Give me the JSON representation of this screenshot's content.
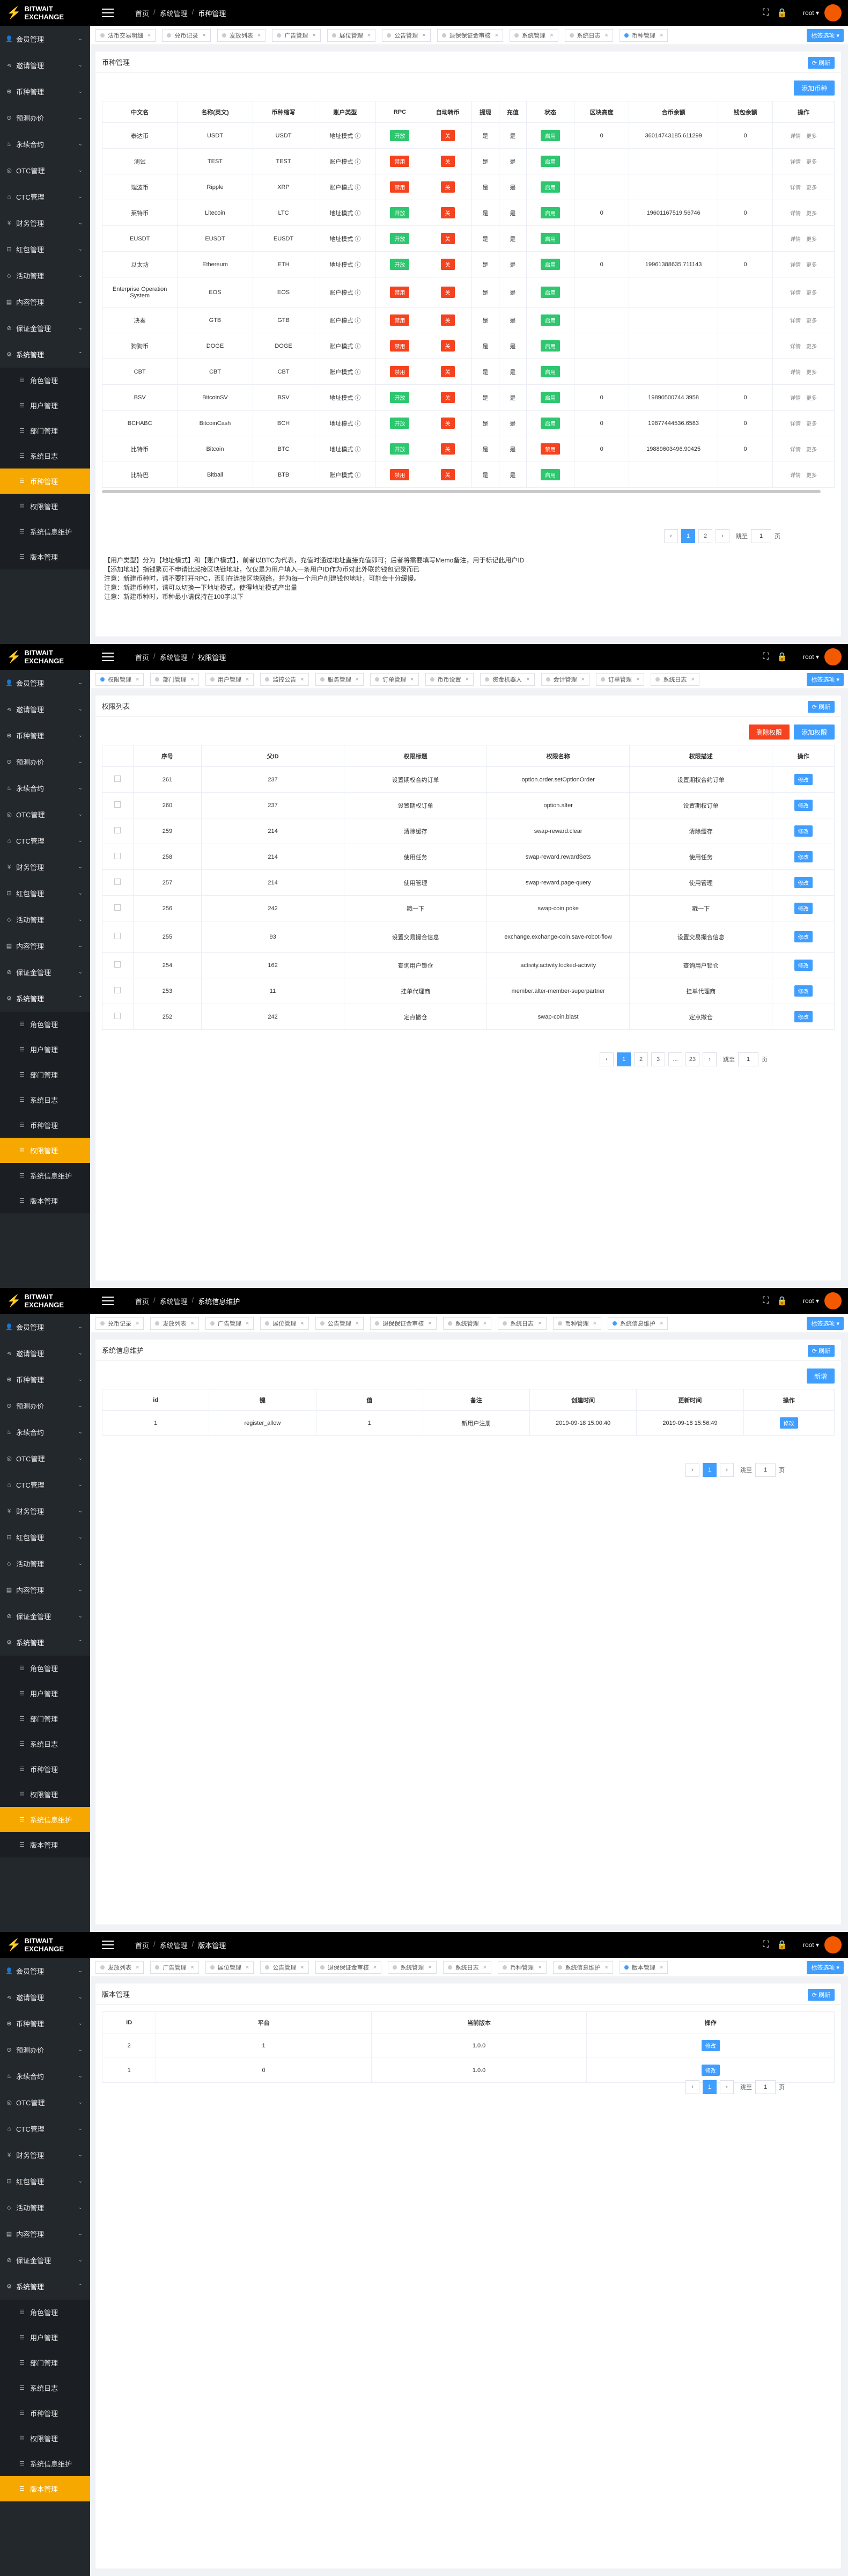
{
  "app": {
    "logo_text": "BITWAIT EXCHANGE",
    "user": "root ▾",
    "tag_nav_label": "标签选项 ▾",
    "refresh_label": "⟳ 刷新"
  },
  "sidebar": {
    "menus": [
      {
        "label": "会员管理",
        "icon": "👤"
      },
      {
        "label": "邀请管理",
        "icon": "⋖"
      },
      {
        "label": "币种管理",
        "icon": "⊕"
      },
      {
        "label": "预测办价",
        "icon": "⊙"
      },
      {
        "label": "永续合约",
        "icon": "♨"
      },
      {
        "label": "OTC管理",
        "icon": "◎"
      },
      {
        "label": "CTC管理",
        "icon": "⌂"
      },
      {
        "label": "财务管理",
        "icon": "¥"
      },
      {
        "label": "红包管理",
        "icon": "⊡"
      },
      {
        "label": "活动管理",
        "icon": "◇"
      },
      {
        "label": "内容管理",
        "icon": "▤"
      },
      {
        "label": "保证金管理",
        "icon": "⊘"
      },
      {
        "label": "系统管理",
        "icon": "⚙"
      }
    ],
    "submenus": [
      {
        "label": "角色管理"
      },
      {
        "label": "用户管理"
      },
      {
        "label": "部门管理"
      },
      {
        "label": "系统日志"
      },
      {
        "label": "币种管理"
      },
      {
        "label": "权限管理"
      },
      {
        "label": "系统信息维护"
      },
      {
        "label": "版本管理"
      }
    ]
  },
  "panels": [
    {
      "breadcrumb": [
        "首页",
        "系统管理",
        "币种管理"
      ],
      "tags": [
        {
          "label": "法币交易明细",
          "active": false
        },
        {
          "label": "兑币记录",
          "active": false
        },
        {
          "label": "发放列表",
          "active": false
        },
        {
          "label": "广告管理",
          "active": false
        },
        {
          "label": "展位管理",
          "active": false
        },
        {
          "label": "公告管理",
          "active": false
        },
        {
          "label": "退保保证金审核",
          "active": false
        },
        {
          "label": "系统管理",
          "active": false
        },
        {
          "label": "系统日志",
          "active": false
        },
        {
          "label": "币种管理",
          "active": true
        }
      ],
      "card_title": "币种管理",
      "toolbar": {
        "add": "添加币种"
      },
      "table": {
        "headers": [
          "中文名",
          "名称(英文)",
          "币种缩写",
          "账户类型",
          "RPC",
          "自动转币",
          "提现",
          "充值",
          "状态",
          "区块高度",
          "合币余额",
          "钱包余额",
          "操作"
        ],
        "rows": [
          {
            "cn": "泰达币",
            "en": "USDT",
            "unit": "USDT",
            "acct": "地址模式 ⓘ",
            "rpc": "开放",
            "rpcc": "g",
            "auto": "关",
            "w": "是",
            "d": "是",
            "st": "启用",
            "h": "0",
            "cb": "36014743185.611299",
            "wb": "0"
          },
          {
            "cn": "测试",
            "en": "TEST",
            "unit": "TEST",
            "acct": "账户模式 ⓘ",
            "rpc": "禁用",
            "rpcc": "r",
            "auto": "关",
            "w": "是",
            "d": "是",
            "st": "启用",
            "h": "",
            "cb": "",
            "wb": ""
          },
          {
            "cn": "瑞波币",
            "en": "Ripple",
            "unit": "XRP",
            "acct": "账户模式 ⓘ",
            "rpc": "禁用",
            "rpcc": "r",
            "auto": "关",
            "w": "是",
            "d": "是",
            "st": "启用",
            "h": "",
            "cb": "",
            "wb": ""
          },
          {
            "cn": "莱特币",
            "en": "Litecoin",
            "unit": "LTC",
            "acct": "地址模式 ⓘ",
            "rpc": "开放",
            "rpcc": "g",
            "auto": "关",
            "w": "是",
            "d": "是",
            "st": "启用",
            "h": "0",
            "cb": "19601167519.56746",
            "wb": "0"
          },
          {
            "cn": "EUSDT",
            "en": "EUSDT",
            "unit": "EUSDT",
            "acct": "地址模式 ⓘ",
            "rpc": "开放",
            "rpcc": "g",
            "auto": "关",
            "w": "是",
            "d": "是",
            "st": "启用",
            "h": "",
            "cb": "",
            "wb": ""
          },
          {
            "cn": "以太坊",
            "en": "Ethereum",
            "unit": "ETH",
            "acct": "地址模式 ⓘ",
            "rpc": "开放",
            "rpcc": "g",
            "auto": "关",
            "w": "是",
            "d": "是",
            "st": "启用",
            "h": "0",
            "cb": "19961388635.711143",
            "wb": "0"
          },
          {
            "cn": "Enterprise Operation System",
            "en": "EOS",
            "unit": "EOS",
            "acct": "账户模式 ⓘ",
            "rpc": "禁用",
            "rpcc": "r",
            "auto": "关",
            "w": "是",
            "d": "是",
            "st": "启用",
            "h": "",
            "cb": "",
            "wb": ""
          },
          {
            "cn": "决奏",
            "en": "GTB",
            "unit": "GTB",
            "acct": "账户模式 ⓘ",
            "rpc": "禁用",
            "rpcc": "r",
            "auto": "关",
            "w": "是",
            "d": "是",
            "st": "启用",
            "h": "",
            "cb": "",
            "wb": ""
          },
          {
            "cn": "狗狗币",
            "en": "DOGE",
            "unit": "DOGE",
            "acct": "账户模式 ⓘ",
            "rpc": "禁用",
            "rpcc": "r",
            "auto": "关",
            "w": "是",
            "d": "是",
            "st": "启用",
            "h": "",
            "cb": "",
            "wb": ""
          },
          {
            "cn": "CBT",
            "en": "CBT",
            "unit": "CBT",
            "acct": "账户模式 ⓘ",
            "rpc": "禁用",
            "rpcc": "r",
            "auto": "关",
            "w": "是",
            "d": "是",
            "st": "启用",
            "h": "",
            "cb": "",
            "wb": ""
          },
          {
            "cn": "BSV",
            "en": "BitcoinSV",
            "unit": "BSV",
            "acct": "地址模式 ⓘ",
            "rpc": "开放",
            "rpcc": "g",
            "auto": "关",
            "w": "是",
            "d": "是",
            "st": "启用",
            "h": "0",
            "cb": "19890500744.3958",
            "wb": "0"
          },
          {
            "cn": "BCHABC",
            "en": "BitcoinCash",
            "unit": "BCH",
            "acct": "地址模式 ⓘ",
            "rpc": "开放",
            "rpcc": "g",
            "auto": "关",
            "w": "是",
            "d": "是",
            "st": "启用",
            "h": "0",
            "cb": "19877444536.6583",
            "wb": "0"
          },
          {
            "cn": "比特币",
            "en": "Bitcoin",
            "unit": "BTC",
            "acct": "地址模式 ⓘ",
            "rpc": "开放",
            "rpcc": "g",
            "auto": "关",
            "w": "是",
            "d": "是",
            "st": "禁用",
            "stc": "r",
            "h": "0",
            "cb": "19889603496.90425",
            "wb": "0"
          },
          {
            "cn": "比特巴",
            "en": "Bitball",
            "unit": "BTB",
            "acct": "账户模式 ⓘ",
            "rpc": "禁用",
            "rpcc": "r",
            "auto": "关",
            "w": "是",
            "d": "是",
            "st": "启用",
            "h": "",
            "cb": "",
            "wb": ""
          }
        ],
        "op_detail": "详情",
        "op_edit": "更多"
      },
      "pager": {
        "pages": [
          "1",
          "2"
        ],
        "goto": "跳至",
        "input": "1",
        "unit": "页"
      },
      "notes": [
        "【用户类型】分为【地址模式】和【账户模式】，前者以BTC为代表，充值时通过地址直接充值即可；后者将需要填写Memo备注，用于标记此用户ID",
        "【添加地址】指钱繁页不申请比起接区块链地址，仅仅是为用户填入一条用户ID作为币对此外联的钱包记录而已",
        "注意：新建币种时，请不要打开RPC，否则在连接区块网络，并为每一个用户创建钱包地址，可能会十分缓慢。",
        "注意：新建币种时，请可以切换一下地址模式，使得地址模式产出量",
        "注意：新建币种时，币种最小请保持在100字以下"
      ]
    },
    {
      "breadcrumb": [
        "首页",
        "系统管理",
        "权限管理"
      ],
      "tags": [
        {
          "label": "权限管理",
          "active": true
        },
        {
          "label": "部门管理",
          "active": false
        },
        {
          "label": "用户管理",
          "active": false
        },
        {
          "label": "监控公告",
          "active": false
        },
        {
          "label": "服务管理",
          "active": false
        },
        {
          "label": "订单管理",
          "active": false
        },
        {
          "label": "币币设置",
          "active": false
        },
        {
          "label": "资金机器人",
          "active": false
        },
        {
          "label": "会计管理",
          "active": false
        },
        {
          "label": "订单管理",
          "active": false
        },
        {
          "label": "系统日志",
          "active": false
        }
      ],
      "card_title": "权限列表",
      "toolbar": {
        "del": "删除权限",
        "add": "添加权限"
      },
      "table": {
        "headers": [
          "",
          "序号",
          "父ID",
          "权限标题",
          "权限名称",
          "权限描述",
          "操作"
        ],
        "rows": [
          {
            "id": "261",
            "pid": "237",
            "title": "设置期权合约订单",
            "name": "option.order.setOptionOrder",
            "desc": "设置期权合约订单"
          },
          {
            "id": "260",
            "pid": "237",
            "title": "设置期权订单",
            "name": "option.alter",
            "desc": "设置期权订单"
          },
          {
            "id": "259",
            "pid": "214",
            "title": "清除缓存",
            "name": "swap-reward.clear",
            "desc": "清除缓存"
          },
          {
            "id": "258",
            "pid": "214",
            "title": "使用任务",
            "name": "swap-reward.rewardSets",
            "desc": "使用任务"
          },
          {
            "id": "257",
            "pid": "214",
            "title": "使用管理",
            "name": "swap-reward.page-query",
            "desc": "使用管理"
          },
          {
            "id": "256",
            "pid": "242",
            "title": "戳一下",
            "name": "swap-coin.poke",
            "desc": "戳一下"
          },
          {
            "id": "255",
            "pid": "93",
            "title": "设置交易撮合信息",
            "name": "exchange.exchange-coin.save-robot-flow",
            "desc": "设置交易撮合信息"
          },
          {
            "id": "254",
            "pid": "162",
            "title": "查询用户锁仓",
            "name": "activity.activity.locked-activity",
            "desc": "查询用户锁仓"
          },
          {
            "id": "253",
            "pid": "11",
            "title": "挂单代理商",
            "name": "member.alter-member-superpartner",
            "desc": "挂单代理商"
          },
          {
            "id": "252",
            "pid": "242",
            "title": "定点撤仓",
            "name": "swap-coin.blast",
            "desc": "定点撤仓"
          }
        ],
        "op": "修改"
      },
      "pager": {
        "pages": [
          "1",
          "2",
          "3",
          "...",
          "23"
        ],
        "goto": "跳至",
        "input": "1",
        "unit": "页"
      }
    },
    {
      "breadcrumb": [
        "首页",
        "系统管理",
        "系统信息维护"
      ],
      "tags": [
        {
          "label": "兑币记录",
          "active": false
        },
        {
          "label": "发放列表",
          "active": false
        },
        {
          "label": "广告管理",
          "active": false
        },
        {
          "label": "展位管理",
          "active": false
        },
        {
          "label": "公告管理",
          "active": false
        },
        {
          "label": "退保保证金审核",
          "active": false
        },
        {
          "label": "系统管理",
          "active": false
        },
        {
          "label": "系统日志",
          "active": false
        },
        {
          "label": "币种管理",
          "active": false
        },
        {
          "label": "系统信息维护",
          "active": true
        }
      ],
      "card_title": "系统信息维护",
      "toolbar": {
        "add": "新增"
      },
      "table": {
        "headers": [
          "id",
          "键",
          "值",
          "备注",
          "创建时间",
          "更新时间",
          "操作"
        ],
        "rows": [
          {
            "id": "1",
            "key": "register_allow",
            "val": "1",
            "remark": "新用户注册",
            "ct": "2019-09-18 15:00:40",
            "ut": "2019-09-18 15:56:49"
          }
        ],
        "op": "修改"
      },
      "pager": {
        "pages": [
          "1"
        ],
        "goto": "跳至",
        "input": "1",
        "unit": "页"
      }
    },
    {
      "breadcrumb": [
        "首页",
        "系统管理",
        "版本管理"
      ],
      "tags": [
        {
          "label": "发放列表",
          "active": false
        },
        {
          "label": "广告管理",
          "active": false
        },
        {
          "label": "展位管理",
          "active": false
        },
        {
          "label": "公告管理",
          "active": false
        },
        {
          "label": "退保保证金审核",
          "active": false
        },
        {
          "label": "系统管理",
          "active": false
        },
        {
          "label": "系统日志",
          "active": false
        },
        {
          "label": "币种管理",
          "active": false
        },
        {
          "label": "系统信息维护",
          "active": false
        },
        {
          "label": "版本管理",
          "active": true
        }
      ],
      "card_title": "版本管理",
      "table": {
        "headers": [
          "ID",
          "平台",
          "当前版本",
          "操作"
        ],
        "rows": [
          {
            "id": "2",
            "plat": "1",
            "ver": "1.0.0"
          },
          {
            "id": "1",
            "plat": "0",
            "ver": "1.0.0"
          }
        ],
        "op": "修改"
      },
      "pager": {
        "pages": [
          "1"
        ],
        "goto": "跳至",
        "input": "1",
        "unit": "页"
      }
    }
  ]
}
